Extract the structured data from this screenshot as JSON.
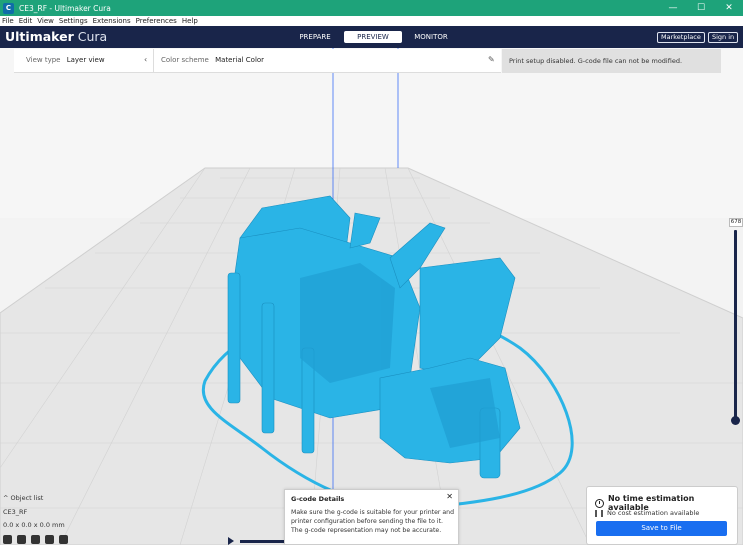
{
  "window": {
    "title": "CE3_RF - Ultimaker Cura",
    "app_icon": "C",
    "controls": {
      "minimize": "—",
      "maximize": "☐",
      "close": "✕"
    }
  },
  "menu": [
    "File",
    "Edit",
    "View",
    "Settings",
    "Extensions",
    "Preferences",
    "Help"
  ],
  "header": {
    "brand_bold": "Ultimaker",
    "brand_light": "Cura",
    "tabs": [
      "PREPARE",
      "PREVIEW",
      "MONITOR"
    ],
    "active_tab": "PREVIEW",
    "marketplace": "Marketplace",
    "signin": "Sign in"
  },
  "viewbar": {
    "view_type_label": "View type",
    "view_type_value": "Layer view",
    "color_scheme_label": "Color scheme",
    "color_scheme_value": "Material Color",
    "notice": "Print setup disabled. G-code file can not be modified."
  },
  "layer_slider": {
    "value": "678"
  },
  "object_list": {
    "title": "Object list",
    "item": "CE3_RF",
    "dims": "0.0 x 0.0 x 0.0 mm"
  },
  "gcode_popup": {
    "title": "G-code Details",
    "close": "✕",
    "body": "Make sure the g-code is suitable for your printer and printer configuration before sending the file to it. The g-code representation may not be accurate."
  },
  "output": {
    "time": "No time estimation available",
    "cost": "No cost estimation available",
    "save": "Save to File"
  },
  "colors": {
    "titlebar": "#1ea37a",
    "header": "#19254a",
    "model": "#2ab4e6",
    "accent": "#196ef0"
  },
  "icons": {
    "view_chevron": "chevron-left-icon",
    "color_edit": "pencil-icon",
    "clock": "clock-icon",
    "cost": "cost-icon",
    "play": "play-icon"
  }
}
